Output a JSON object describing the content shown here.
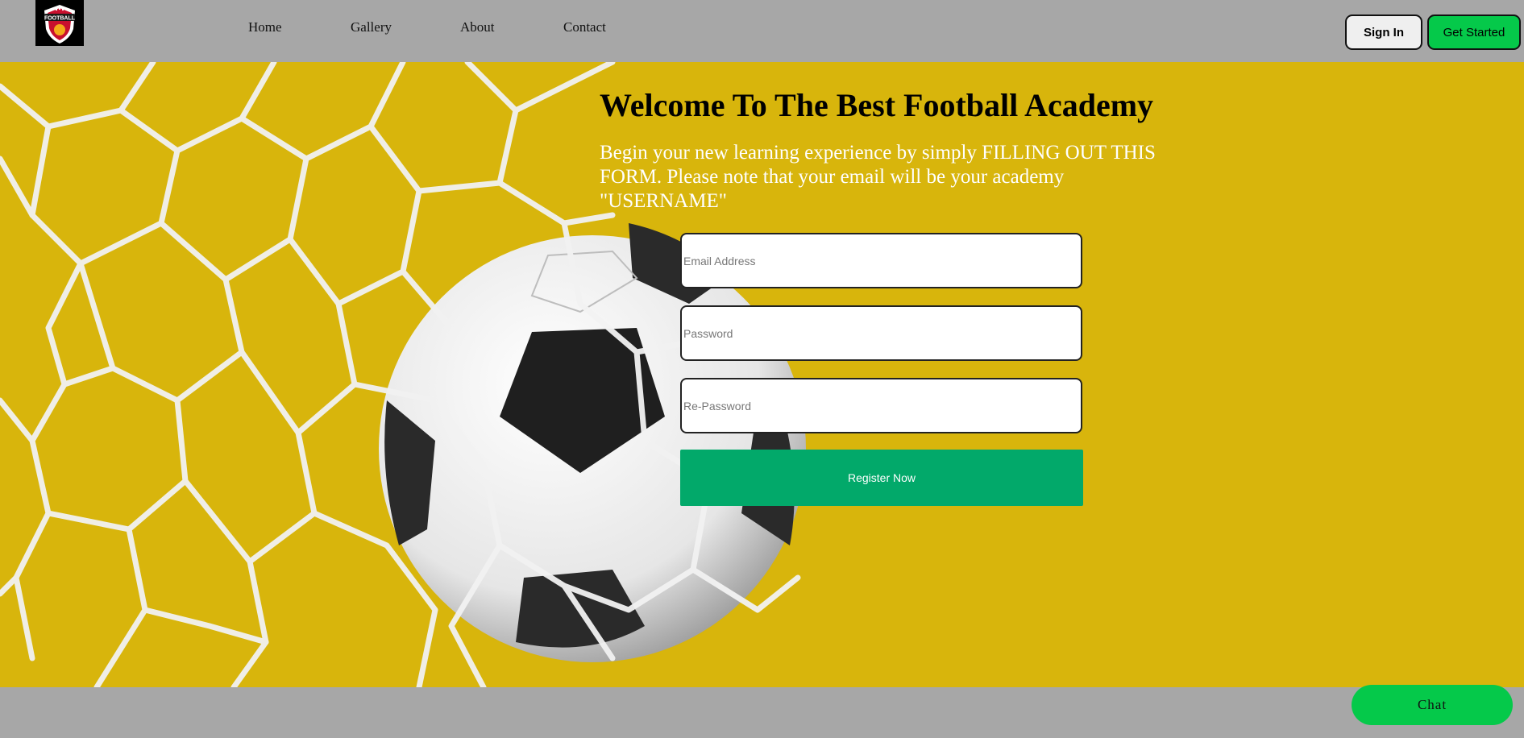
{
  "brand": {
    "logo_text": "FOOTBALL"
  },
  "nav": {
    "links": [
      {
        "label": "Home"
      },
      {
        "label": "Gallery"
      },
      {
        "label": "About"
      },
      {
        "label": "Contact"
      }
    ],
    "signin_label": "Sign In",
    "get_started_label": "Get Started"
  },
  "hero": {
    "title": "Welcome To The Best Football Academy",
    "subtitle": "Begin your new learning experience by simply FILLING OUT THIS FORM. Please note that your email will be your academy \"USERNAME\""
  },
  "form": {
    "email_placeholder": "Email Address",
    "password_placeholder": "Password",
    "repassword_placeholder": "Re-Password",
    "submit_label": "Register Now"
  },
  "chat": {
    "label": "Chat"
  },
  "colors": {
    "navbar": "#a7a7a7",
    "hero_background": "#d8b50c",
    "brand_green": "#05c94a",
    "register_green": "#02a96a"
  }
}
